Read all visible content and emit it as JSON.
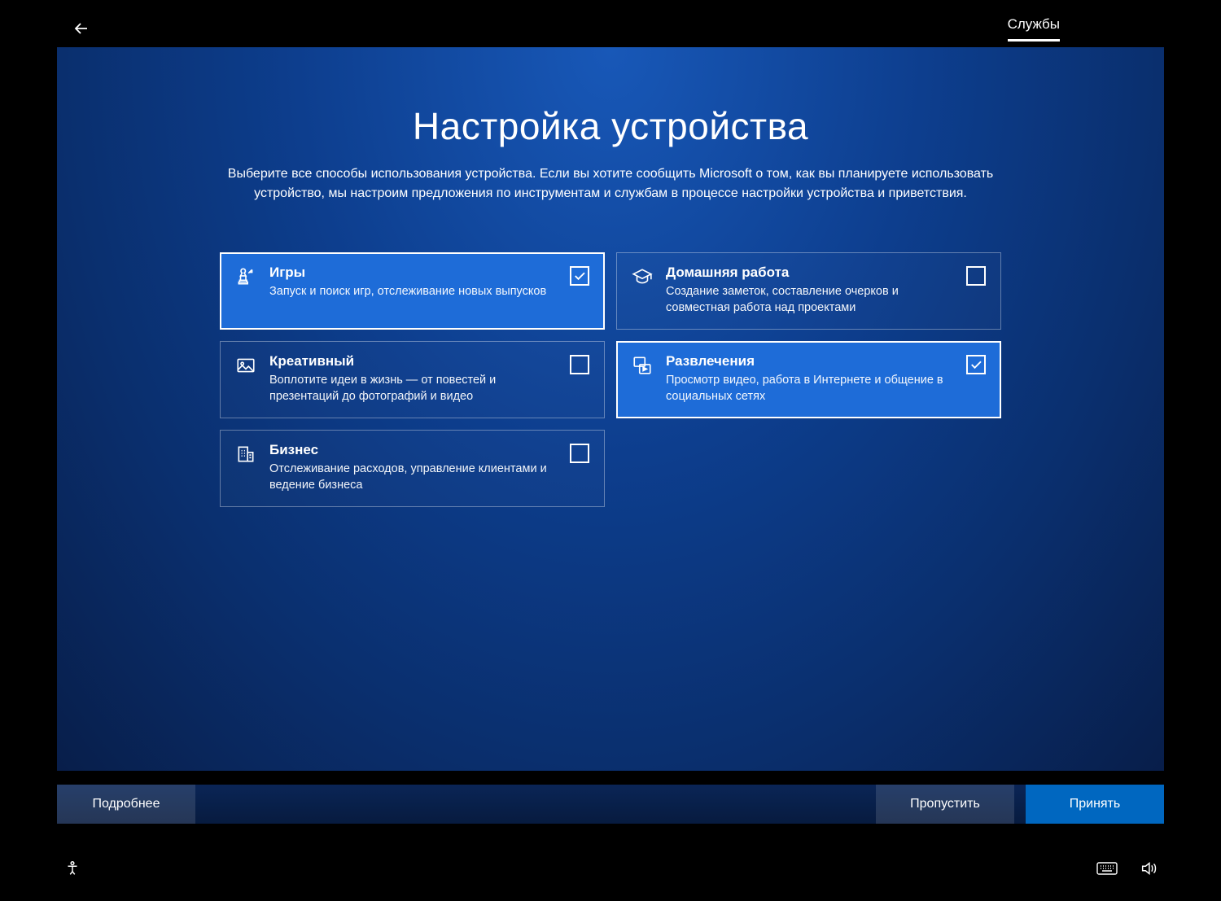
{
  "header": {
    "tab_label": "Службы"
  },
  "main": {
    "title": "Настройка устройства",
    "subtitle": "Выберите все способы использования устройства. Если вы хотите сообщить Microsoft о том, как вы планируете использовать устройство, мы настроим предложения по инструментам и службам в процессе настройки устройства и приветствия."
  },
  "cards": [
    {
      "id": "gaming",
      "title": "Игры",
      "desc": "Запуск и поиск игр, отслеживание новых выпусков",
      "selected": true
    },
    {
      "id": "homework",
      "title": "Домашняя работа",
      "desc": "Создание заметок, составление очерков и совместная работа над проектами",
      "selected": false
    },
    {
      "id": "creative",
      "title": "Креативный",
      "desc": "Воплотите идеи в жизнь — от повестей и презентаций до фотографий и видео",
      "selected": false
    },
    {
      "id": "entertainment",
      "title": "Развлечения",
      "desc": "Просмотр видео, работа в Интернете и общение в социальных сетях",
      "selected": true
    },
    {
      "id": "business",
      "title": "Бизнес",
      "desc": "Отслеживание расходов, управление клиентами и ведение бизнеса",
      "selected": false
    }
  ],
  "buttons": {
    "learn_more": "Подробнее",
    "skip": "Пропустить",
    "accept": "Принять"
  }
}
